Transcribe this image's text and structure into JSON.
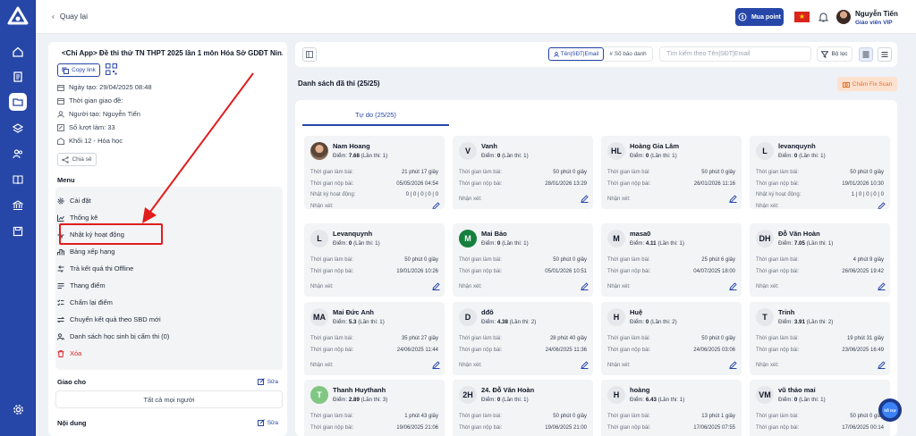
{
  "topbar": {
    "back_label": "Quay lại",
    "buy_point_label": "Mua point",
    "user_name": "Nguyễn Tiến",
    "user_role": "Giáo viên VIP"
  },
  "exam": {
    "title": "<Chỉ App> Đề thi thử TN THPT 2025 lần 1 môn Hóa Sở GDĐT Nin...",
    "copy_link_label": "Copy link",
    "created_date": "Ngày tạo: 29/04/2025 08:48",
    "exam_time": "Thời gian giao đề:",
    "creator": "Người tạo: Nguyễn Tiến",
    "attempts": "Số lượt làm: 33",
    "grade": "Khối 12 - Hóa học",
    "share_label": "Chia sẻ"
  },
  "menu": {
    "title": "Menu",
    "items": [
      {
        "label": "Cài đặt"
      },
      {
        "label": "Thống kê"
      },
      {
        "label": "Nhật ký hoạt động"
      },
      {
        "label": "Bảng xếp hạng"
      },
      {
        "label": "Trả kết quả thi Offline"
      },
      {
        "label": "Thang điểm"
      },
      {
        "label": "Chấm lại điểm"
      },
      {
        "label": "Chuyển kết quả theo SBD mới"
      },
      {
        "label": "Danh sách học sinh bị cấm thi (0)"
      },
      {
        "label": "Xóa"
      }
    ]
  },
  "assign": {
    "title": "Giao cho",
    "edit_label": "Sửa",
    "value": "Tất cả mọi người"
  },
  "content": {
    "title": "Nội dung",
    "edit_label": "Sửa"
  },
  "toolbar": {
    "seg_name_label": "Tên|SĐT|Email",
    "seg_sbd_label": "Số báo danh",
    "search_placeholder": "Tìm kiếm theo Tên|SĐT|Email",
    "filter_label": "Bộ lọc"
  },
  "list": {
    "title": "Danh sách đã thi (25/25)",
    "fix_scan_label": "Chấm Fix Scan",
    "tab_label": "Tự do (25/25)"
  },
  "labels": {
    "time_spent": "Thời gian làm bài:",
    "submit_time": "Thời gian nộp bài:",
    "activity_log": "Nhật ký hoạt động:",
    "comment": "Nhận xét:",
    "score_prefix": "Điểm: "
  },
  "cards": [
    {
      "name": "Nam Hoang",
      "initials": "",
      "avatar": "photo",
      "score": "7.68",
      "attempt": "(Lần thi: 1)",
      "time_spent": "21 phút 17 giây",
      "submit_time": "05/05/2026 04:54",
      "activity": "0 | 0 | 0 | 0 | 0"
    },
    {
      "name": "Vanh",
      "initials": "V",
      "avatar": "gray",
      "score": "0",
      "attempt": "(Lần thi: 1)",
      "time_spent": "50 phút 0 giây",
      "submit_time": "28/01/2026 13:29",
      "activity": ""
    },
    {
      "name": "Hoàng Gia Lâm",
      "initials": "HL",
      "avatar": "gray",
      "score": "0",
      "attempt": "(Lần thi: 1)",
      "time_spent": "50 phút 0 giây",
      "submit_time": "26/01/2026 11:16",
      "activity": ""
    },
    {
      "name": "levanquynh",
      "initials": "L",
      "avatar": "gray",
      "score": "0",
      "attempt": "(Lần thi: 1)",
      "time_spent": "50 phút 0 giây",
      "submit_time": "19/01/2026 10:30",
      "activity": "1 | 0 | 0 | 0 | 0"
    },
    {
      "name": "Levanquynh",
      "initials": "L",
      "avatar": "gray",
      "score": "0",
      "attempt": "(Lần thi: 1)",
      "time_spent": "50 phút 0 giây",
      "submit_time": "19/01/2026 10:26",
      "activity": ""
    },
    {
      "name": "Mai Bảo",
      "initials": "M",
      "avatar": "green",
      "score": "0",
      "attempt": "(Lần thi: 1)",
      "time_spent": "50 phút 0 giây",
      "submit_time": "05/01/2026 10:51",
      "activity": ""
    },
    {
      "name": "masa0",
      "initials": "M",
      "avatar": "gray",
      "score": "4.11",
      "attempt": "(Lần thi: 1)",
      "time_spent": "25 phút 6 giây",
      "submit_time": "04/07/2025 18:00",
      "activity": ""
    },
    {
      "name": "Đỗ Văn Hoàn",
      "initials": "DH",
      "avatar": "gray",
      "score": "7.05",
      "attempt": "(Lần thi: 1)",
      "time_spent": "4 phút 9 giây",
      "submit_time": "26/06/2025 19:42",
      "activity": ""
    },
    {
      "name": "Mai Đức Anh",
      "initials": "MA",
      "avatar": "gray",
      "score": "5.3",
      "attempt": "(Lần thi: 1)",
      "time_spent": "35 phút 27 giây",
      "submit_time": "24/06/2025 11:44",
      "activity": ""
    },
    {
      "name": "dđô",
      "initials": "D",
      "avatar": "gray",
      "score": "4.38",
      "attempt": "(Lần thi: 2)",
      "time_spent": "28 phút 40 giây",
      "submit_time": "24/06/2025 11:36",
      "activity": ""
    },
    {
      "name": "Huệ",
      "initials": "H",
      "avatar": "gray",
      "score": "0",
      "attempt": "(Lần thi: 2)",
      "time_spent": "50 phút 0 giây",
      "submit_time": "24/06/2025 03:06",
      "activity": ""
    },
    {
      "name": "Trinh",
      "initials": "T",
      "avatar": "gray",
      "score": "3.91",
      "attempt": "(Lần thi: 2)",
      "time_spent": "19 phút 31 giây",
      "submit_time": "23/06/2025 16:49",
      "activity": ""
    },
    {
      "name": "Thanh Huythanh",
      "initials": "T",
      "avatar": "green2",
      "score": "2.89",
      "attempt": "(Lần thi: 3)",
      "time_spent": "1 phút 43 giây",
      "submit_time": "19/06/2025 21:06",
      "activity": ""
    },
    {
      "name": "24. Đỗ Văn Hoàn",
      "initials": "2H",
      "avatar": "gray",
      "score": "0",
      "attempt": "(Lần thi: 1)",
      "time_spent": "50 phút 0 giây",
      "submit_time": "19/06/2025 21:00",
      "activity": ""
    },
    {
      "name": "hoàng",
      "initials": "H",
      "avatar": "gray",
      "score": "6.43",
      "attempt": "(Lần thi: 1)",
      "time_spent": "13 phút 1 giây",
      "submit_time": "17/06/2025 07:55",
      "activity": ""
    },
    {
      "name": "vũ thảo mai",
      "initials": "VM",
      "avatar": "gray",
      "score": "0",
      "attempt": "(Lần thi: 1)",
      "time_spent": "50 phút 0 giây",
      "submit_time": "17/06/2025 00:14",
      "activity": ""
    }
  ],
  "colors": {
    "primary": "#2747a8",
    "highlight": "#e11d1d",
    "danger": "#dc2626"
  }
}
